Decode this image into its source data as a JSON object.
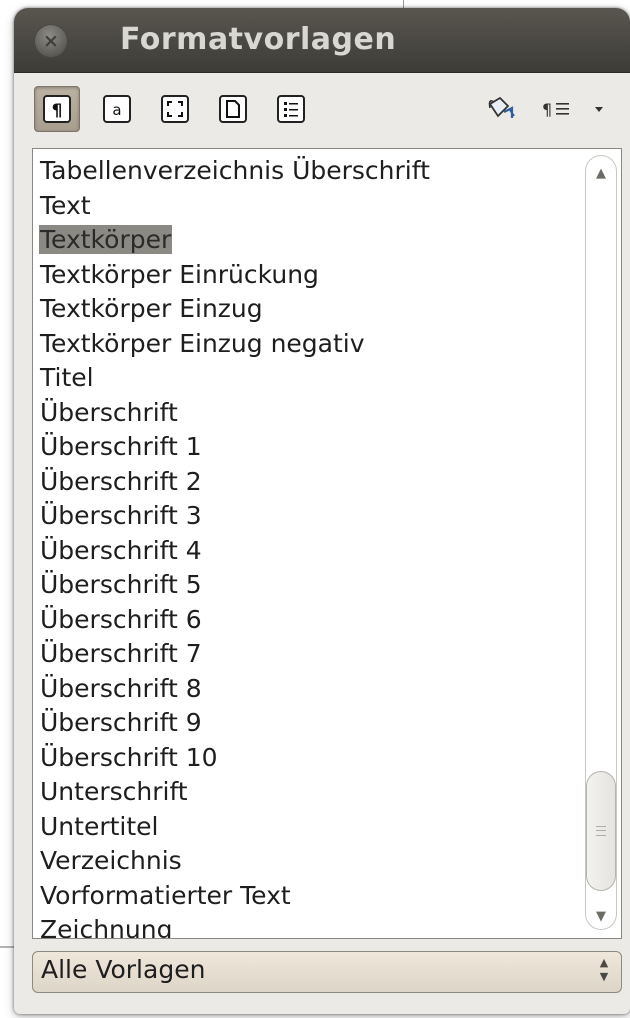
{
  "window": {
    "title": "Formatvorlagen"
  },
  "toolbar": {
    "buttons": [
      {
        "icon": "paragraph-styles-icon",
        "pressed": true
      },
      {
        "icon": "character-styles-icon",
        "pressed": false
      },
      {
        "icon": "frame-styles-icon",
        "pressed": false
      },
      {
        "icon": "page-styles-icon",
        "pressed": false
      },
      {
        "icon": "list-styles-icon",
        "pressed": false
      },
      {
        "icon": "fill-format-mode-icon",
        "pressed": false
      },
      {
        "icon": "new-style-from-selection-icon",
        "pressed": false
      },
      {
        "icon": "dropdown-arrow-icon",
        "pressed": false
      }
    ]
  },
  "styles_list": {
    "items": [
      "Tabellenverzeichnis Überschrift",
      "Text",
      "Textkörper",
      "Textkörper Einrückung",
      "Textkörper Einzug",
      "Textkörper Einzug negativ",
      "Titel",
      "Überschrift",
      "Überschrift 1",
      "Überschrift 2",
      "Überschrift 3",
      "Überschrift 4",
      "Überschrift 5",
      "Überschrift 6",
      "Überschrift 7",
      "Überschrift 8",
      "Überschrift 9",
      "Überschrift 10",
      "Unterschrift",
      "Untertitel",
      "Verzeichnis",
      "Vorformatierter Text",
      "Zeichnung"
    ],
    "selected_index": 2
  },
  "filter": {
    "selected": "Alle Vorlagen"
  },
  "colors": {
    "titlebar": "#3d3c37",
    "selection": "#8a8984",
    "pressed_button": "#a89e8f"
  }
}
